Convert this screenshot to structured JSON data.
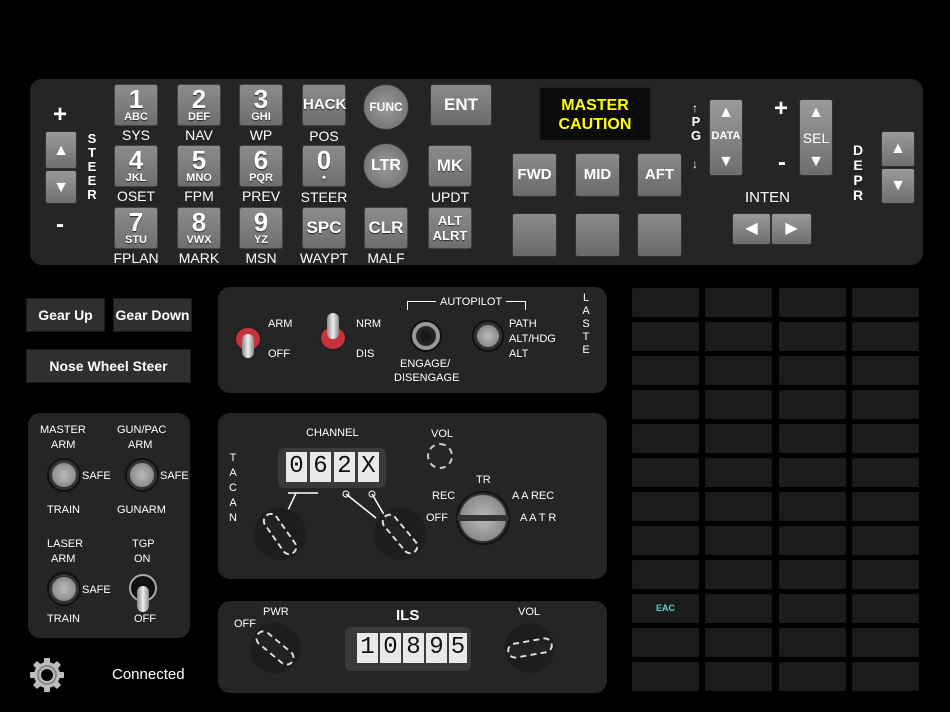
{
  "ufc": {
    "steer": {
      "plus": "+",
      "minus": "-",
      "label": "STEER",
      "up": "▲",
      "down": "▼"
    },
    "keys": [
      {
        "big": "1",
        "small": "ABC",
        "under": "SYS"
      },
      {
        "big": "2",
        "small": "DEF",
        "under": "NAV"
      },
      {
        "big": "3",
        "small": "GHI",
        "under": "WP"
      },
      {
        "big": "4",
        "small": "JKL",
        "under": "OSET"
      },
      {
        "big": "5",
        "small": "MNO",
        "under": "FPM"
      },
      {
        "big": "6",
        "small": "PQR",
        "under": "PREV"
      },
      {
        "big": "7",
        "small": "STU",
        "under": "FPLAN"
      },
      {
        "big": "8",
        "small": "VWX",
        "under": "MARK"
      },
      {
        "big": "9",
        "small": "YZ",
        "under": "MSN"
      }
    ],
    "hack": {
      "label": "HACK",
      "under": "POS"
    },
    "zero": {
      "big": "0",
      "small": "•",
      "under": "STEER"
    },
    "spc": {
      "label": "SPC",
      "under": "WAYPT"
    },
    "func": "FUNC",
    "ltr": "LTR",
    "clr": {
      "label": "CLR",
      "under": "MALF"
    },
    "ent": "ENT",
    "mk": {
      "label": "MK",
      "under": "UPDT"
    },
    "altalrt": {
      "line1": "ALT",
      "line2": "ALRT"
    },
    "master_caution": {
      "line1": "MASTER",
      "line2": "CAUTION",
      "color": "#ffff00"
    },
    "fwd": "FWD",
    "mid": "MID",
    "aft": "AFT",
    "pg": "PG",
    "data": "DATA",
    "sel": "SEL",
    "plus": "+",
    "minus": "-",
    "inten": "INTEN",
    "left_arrow": "◀",
    "right_arrow": "▶",
    "depr": "DEPR"
  },
  "buttons": {
    "gear_up": "Gear Up",
    "gear_down": "Gear Down",
    "nose_wheel": "Nose Wheel Steer"
  },
  "autopilot_panel": {
    "arm": "ARM",
    "off": "OFF",
    "nrm": "NRM",
    "dis": "DIS",
    "autopilot": "AUTOPILOT",
    "engage": "ENGAGE/",
    "disengage": "DISENGAGE",
    "path": "PATH",
    "alt_hdg": "ALT/HDG",
    "alt": "ALT",
    "laste": "LASTE"
  },
  "armament": {
    "master1": "MASTER",
    "master2": "ARM",
    "gunpac1": "GUN/PAC",
    "gunpac2": "ARM",
    "safe": "SAFE",
    "train": "TRAIN",
    "gunarm": "GUNARM",
    "laser1": "LASER",
    "laser2": "ARM",
    "tgp1": "TGP",
    "tgp2": "ON",
    "off": "OFF"
  },
  "tacan": {
    "label": "TACAN",
    "channel": "CHANNEL",
    "digits": [
      "0",
      "6",
      "2",
      "X"
    ],
    "vol": "VOL",
    "tr": "TR",
    "rec": "REC",
    "off": "OFF",
    "aarec": "A A REC",
    "aatr": "A A T R"
  },
  "ils": {
    "title": "ILS",
    "pwr": "PWR",
    "off": "OFF",
    "vol": "VOL",
    "digits": [
      "1",
      "0",
      "8",
      "9",
      "5"
    ]
  },
  "grid": {
    "eac": "EAC",
    "eac_color": "#58d8c8"
  },
  "status": {
    "connected": "Connected"
  },
  "icons": {
    "settings": "gear-icon"
  }
}
